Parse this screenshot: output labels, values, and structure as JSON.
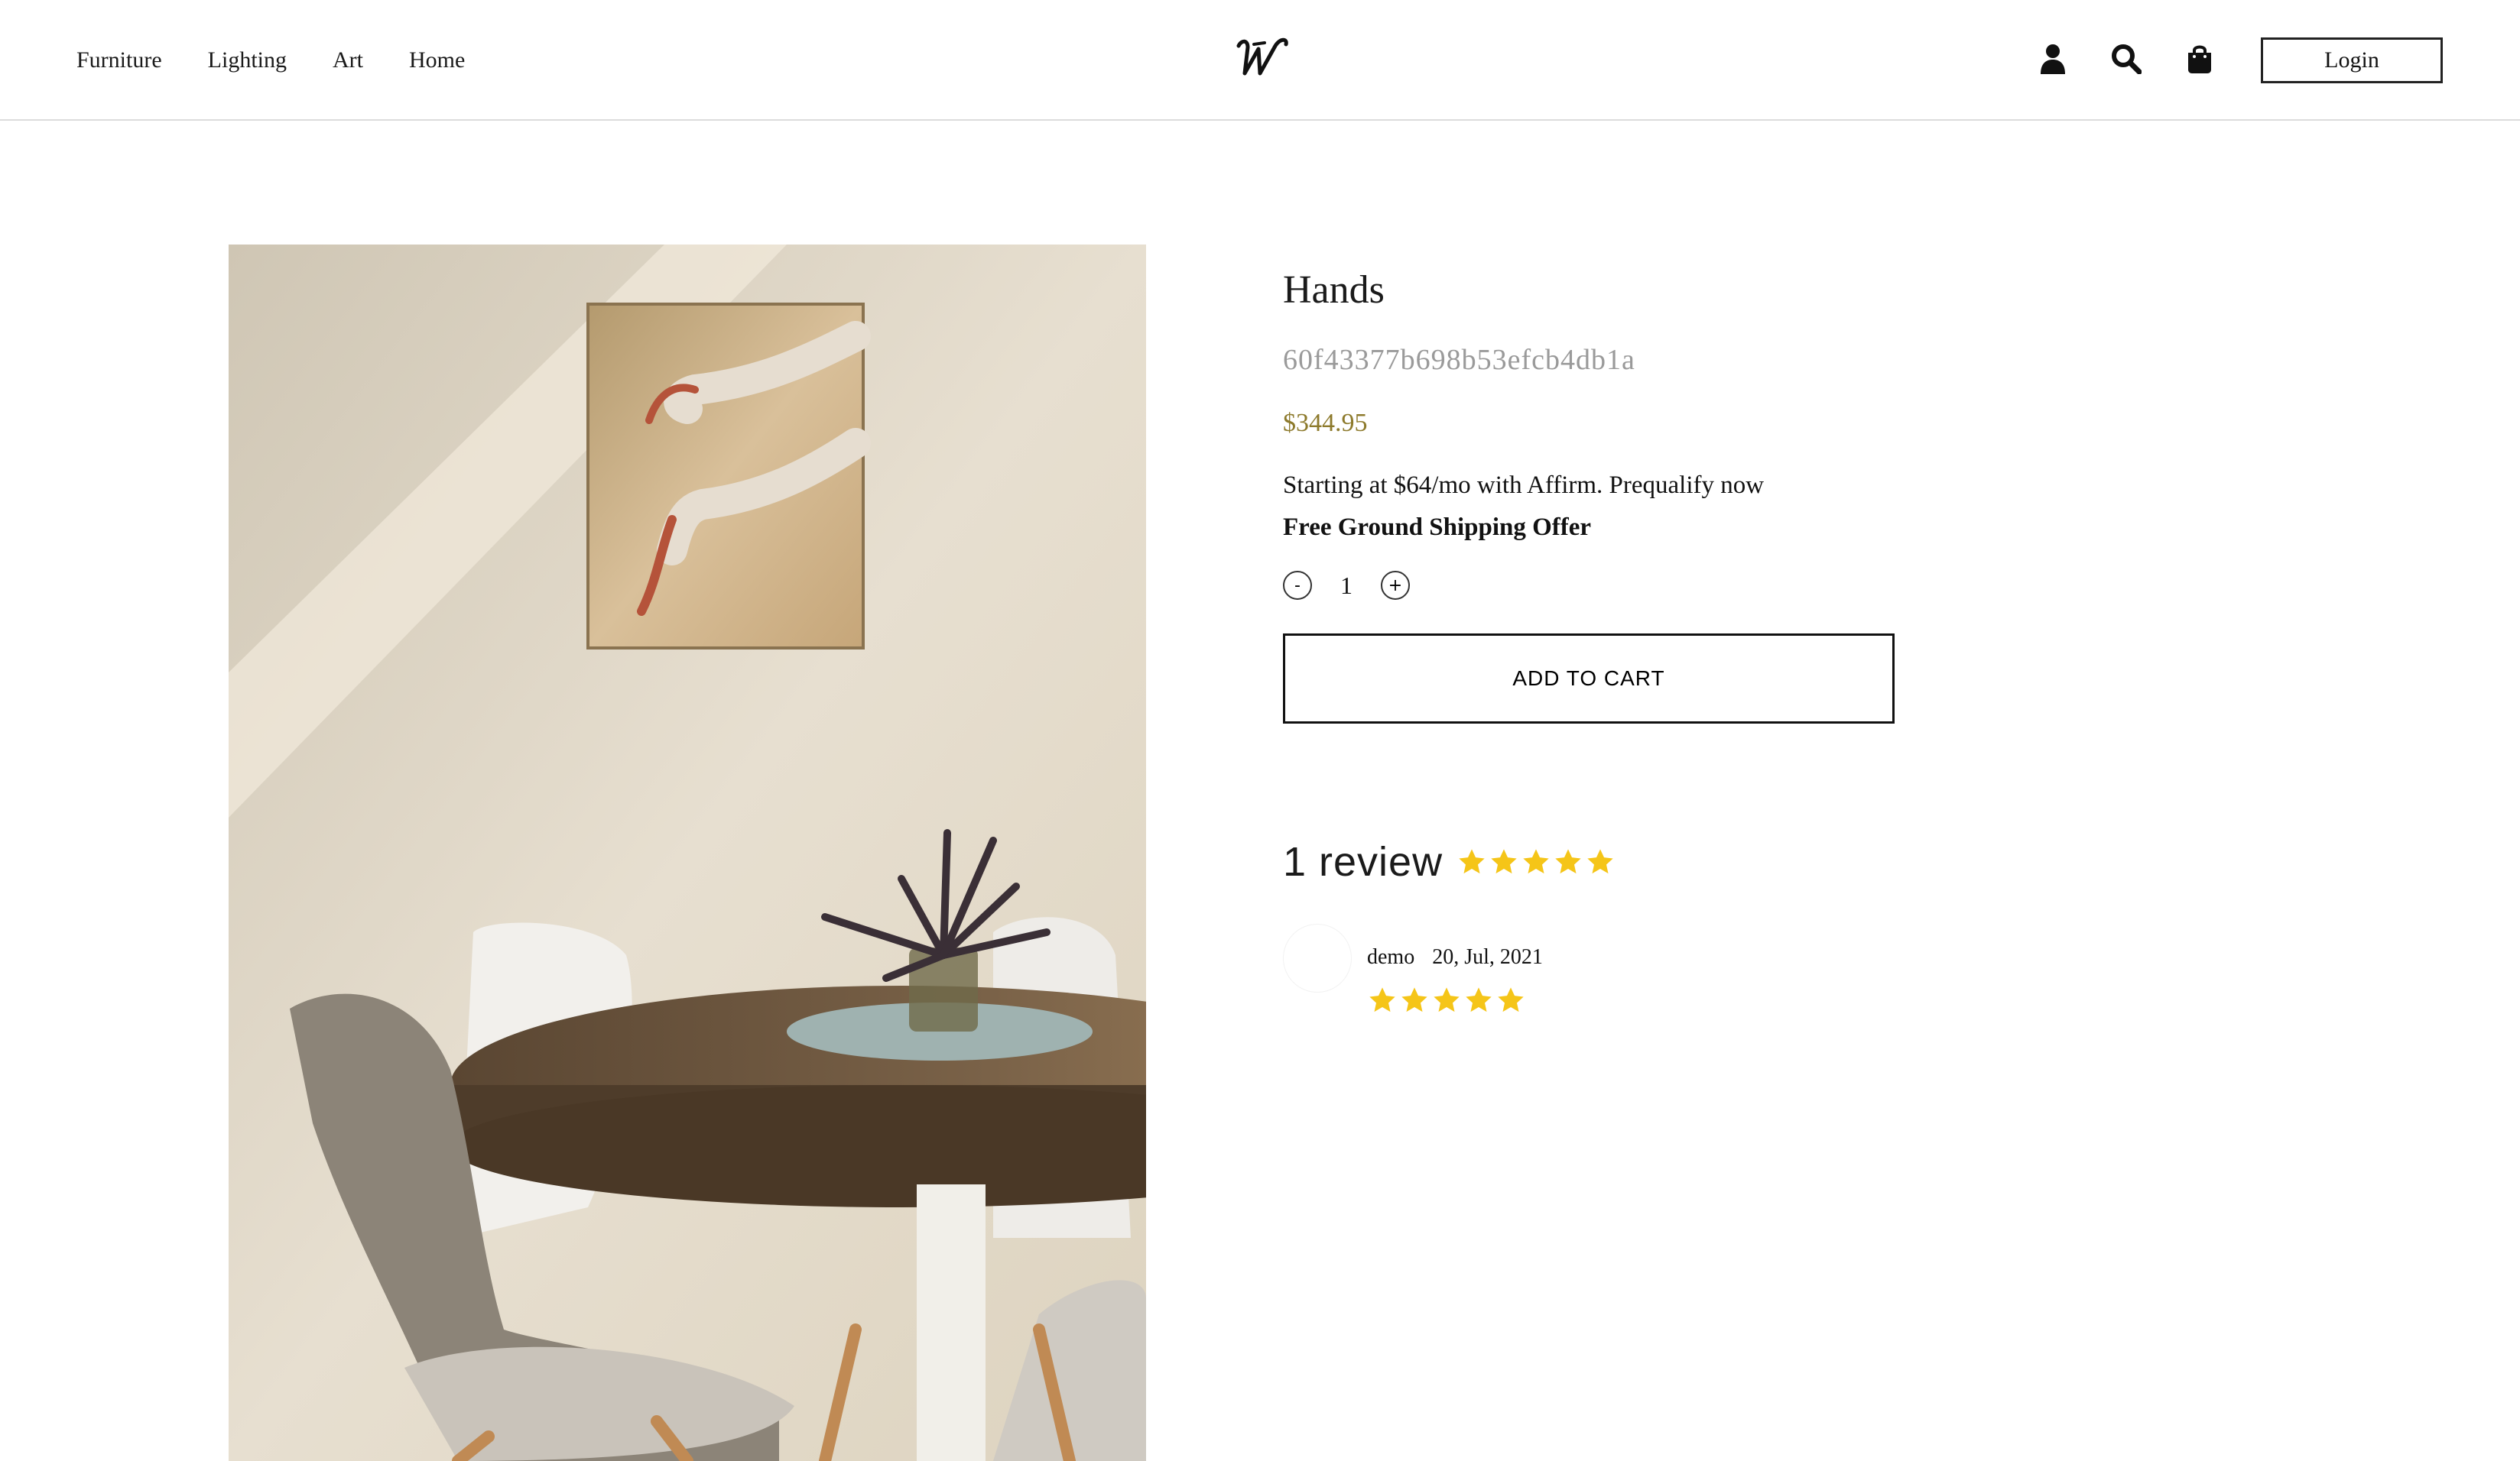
{
  "header": {
    "nav": [
      "Furniture",
      "Lighting",
      "Art",
      "Home"
    ],
    "logo_text": "W",
    "icons": [
      "user-icon",
      "search-icon",
      "shopping-bag-icon"
    ],
    "login_label": "Login"
  },
  "product": {
    "title": "Hands",
    "sku": "60f43377b698b53efcb4db1a",
    "price": "$344.95",
    "affirm_text": "Starting at $64/mo with Affirm. Prequalify now",
    "shipping_text": "Free Ground Shipping Offer",
    "quantity": "1",
    "decrement_label": "-",
    "increment_label": "+",
    "add_to_cart_label": "ADD TO CART"
  },
  "reviews": {
    "title": "1 review",
    "average_rating": 5,
    "items": [
      {
        "author": "demo",
        "date": "20, Jul, 2021",
        "rating": 5
      }
    ]
  },
  "colors": {
    "price": "#8d7a2c",
    "star": "#f5c518",
    "text": "#111111"
  }
}
